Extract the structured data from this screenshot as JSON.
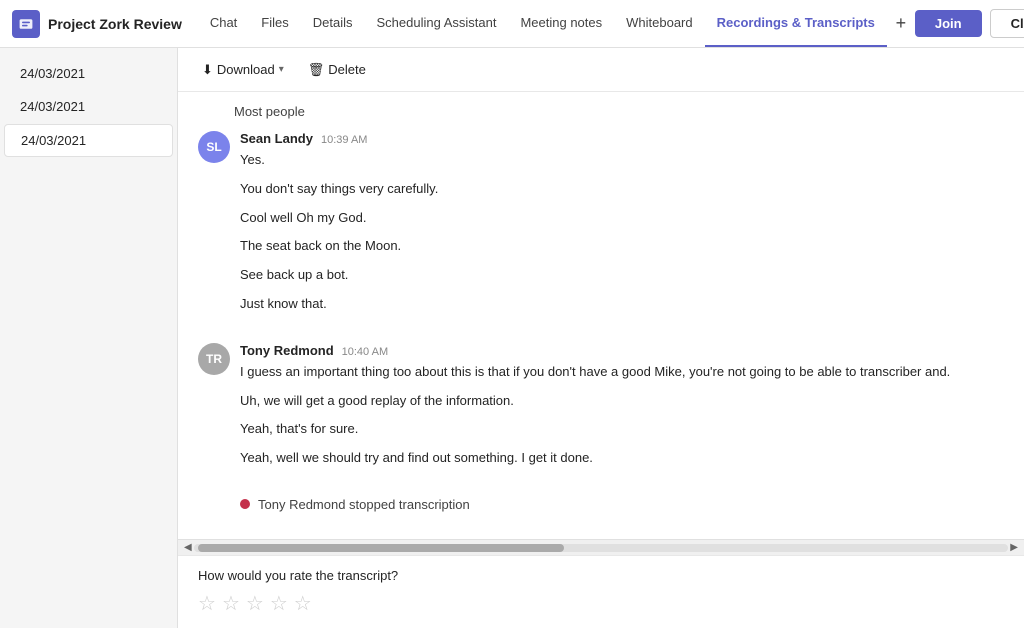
{
  "app": {
    "icon_label": "Teams icon",
    "title": "Project Zork Review"
  },
  "nav": {
    "tabs": [
      {
        "id": "chat",
        "label": "Chat",
        "active": false
      },
      {
        "id": "files",
        "label": "Files",
        "active": false
      },
      {
        "id": "details",
        "label": "Details",
        "active": false
      },
      {
        "id": "scheduling",
        "label": "Scheduling Assistant",
        "active": false
      },
      {
        "id": "meeting-notes",
        "label": "Meeting notes",
        "active": false
      },
      {
        "id": "whiteboard",
        "label": "Whiteboard",
        "active": false
      },
      {
        "id": "recordings",
        "label": "Recordings & Transcripts",
        "active": true
      }
    ],
    "add_tab_label": "+"
  },
  "header_actions": {
    "join_label": "Join",
    "close_label": "Close"
  },
  "sidebar": {
    "items": [
      {
        "date": "24/03/2021",
        "active": false
      },
      {
        "date": "24/03/2021",
        "active": false
      },
      {
        "date": "24/03/2021",
        "active": true
      }
    ]
  },
  "toolbar": {
    "download_label": "Download",
    "delete_label": "Delete"
  },
  "transcript": {
    "section_label": "Most people",
    "messages": [
      {
        "id": "msg1",
        "sender": "Sean Landy",
        "time": "10:39 AM",
        "avatar_initials": "SL",
        "avatar_type": "sean",
        "lines": [
          "Yes.",
          "You don't say things very carefully.",
          "Cool well Oh my God.",
          "The seat back on the Moon.",
          "See back up a bot.",
          "Just know that."
        ]
      },
      {
        "id": "msg2",
        "sender": "Tony Redmond",
        "time": "10:40 AM",
        "avatar_initials": "TR",
        "avatar_type": "tony",
        "lines": [
          "I guess an important thing too about this is that if you don't have a good Mike, you're not going to be able to transcriber and.",
          "Uh, we will get a good replay of the information.",
          "Yeah, that's for sure.",
          "Yeah, well we should try and find out something. I get it done."
        ]
      }
    ],
    "stop_notice": "Tony Redmond stopped transcription"
  },
  "rating": {
    "label": "How would you rate the transcript?",
    "stars": [
      1,
      2,
      3,
      4,
      5
    ]
  }
}
